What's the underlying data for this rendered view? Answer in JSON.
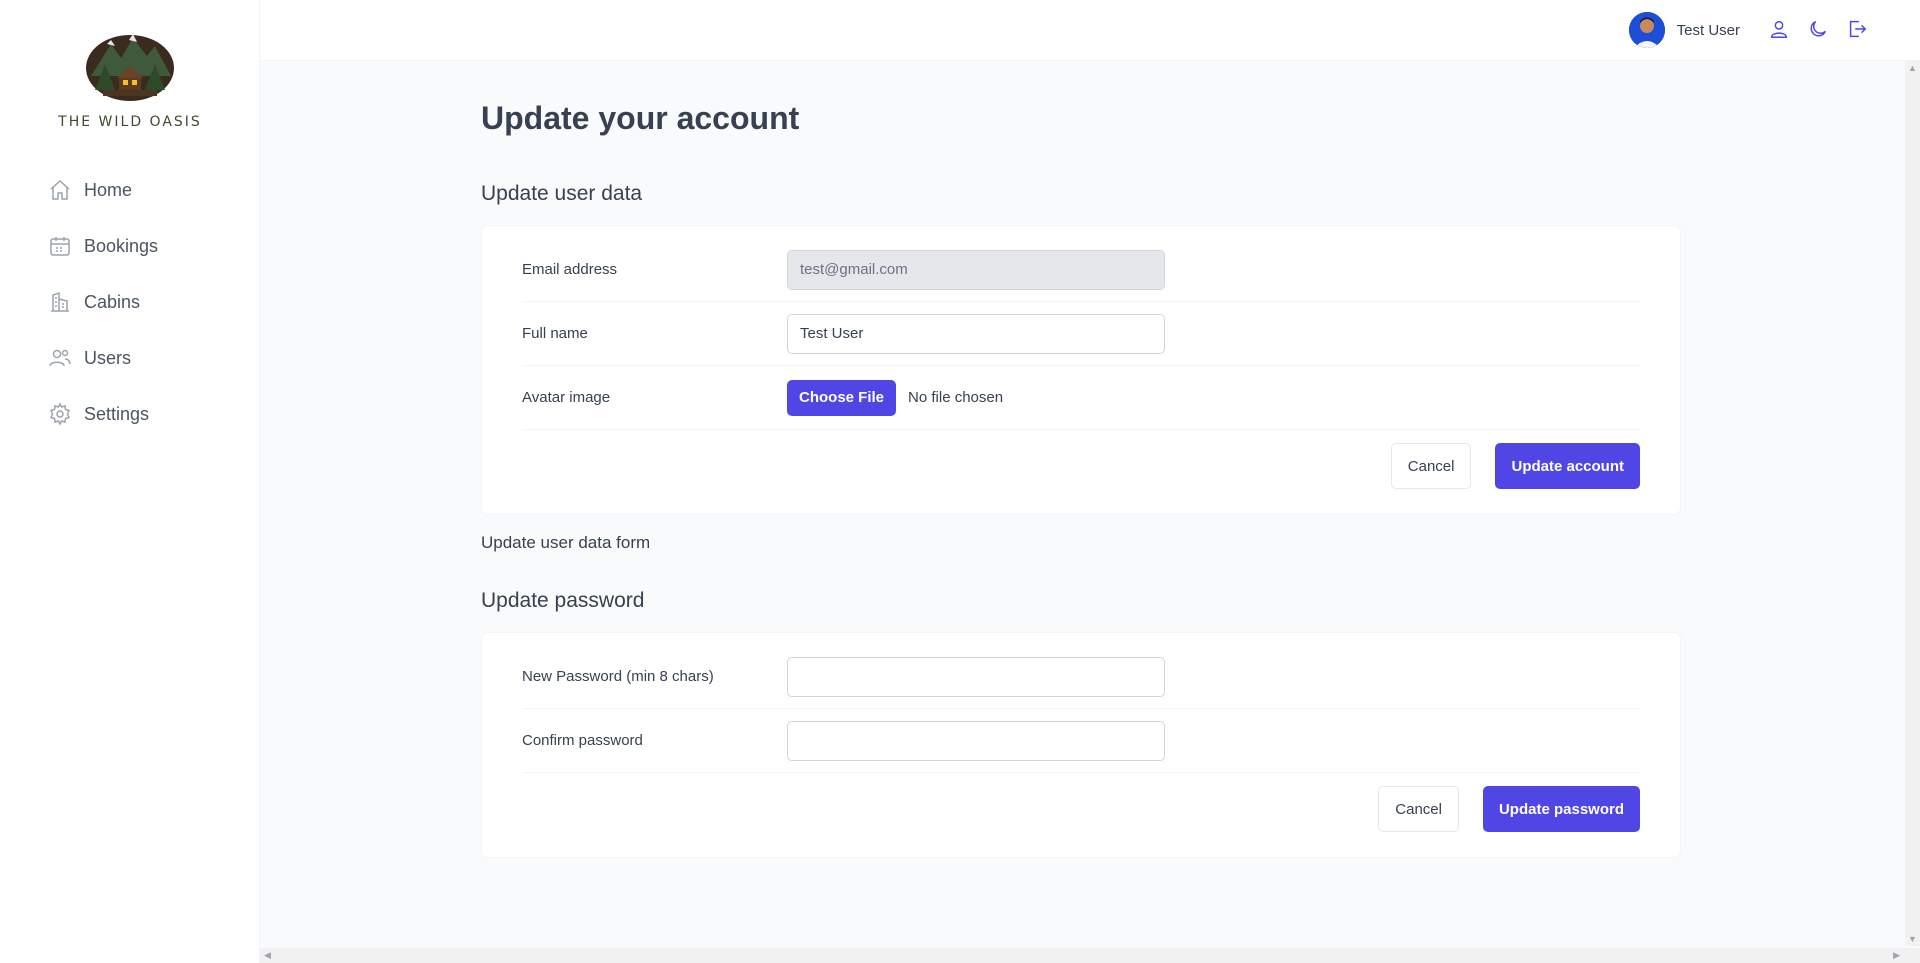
{
  "app": {
    "name": "THE WILD OASIS"
  },
  "sidebar": {
    "items": [
      {
        "label": "Home",
        "icon": "home-icon"
      },
      {
        "label": "Bookings",
        "icon": "calendar-icon"
      },
      {
        "label": "Cabins",
        "icon": "building-icon"
      },
      {
        "label": "Users",
        "icon": "users-icon"
      },
      {
        "label": "Settings",
        "icon": "gear-icon"
      }
    ]
  },
  "header": {
    "user_name": "Test User",
    "icons": [
      "user-icon",
      "moon-icon",
      "logout-icon"
    ]
  },
  "page": {
    "title": "Update your account"
  },
  "user_data": {
    "section_title": "Update user data",
    "email_label": "Email address",
    "email_value": "test@gmail.com",
    "fullname_label": "Full name",
    "fullname_value": "Test User",
    "avatar_label": "Avatar image",
    "choose_file": "Choose File",
    "no_file": "No file chosen",
    "cancel": "Cancel",
    "submit": "Update account",
    "form_note": "Update user data form"
  },
  "password": {
    "section_title": "Update password",
    "new_label": "New Password (min 8 chars)",
    "confirm_label": "Confirm password",
    "cancel": "Cancel",
    "submit": "Update password"
  },
  "colors": {
    "accent": "#4f46e5",
    "background": "#f9fafb"
  }
}
